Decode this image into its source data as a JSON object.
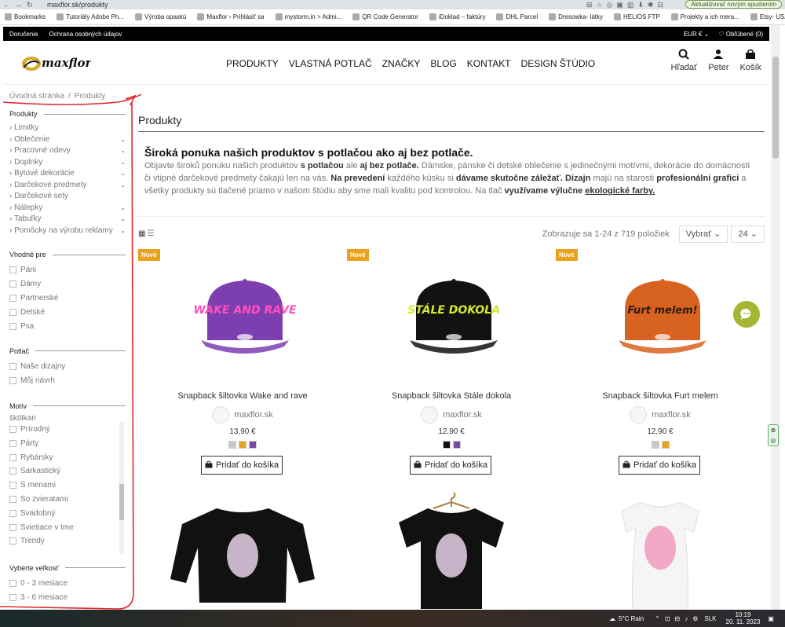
{
  "browser": {
    "url": "maxflor.sk/produkty",
    "update_label": "Aktualizovať  novým spustením",
    "bookmarks": [
      "Bookmarks",
      "Tutoriály Adobe Ph...",
      "Výroba opaskú",
      "Maxflor › Prihlásiť sa",
      "mystorm.in > Admi...",
      "QR Code Generator",
      "iDoklad – faktúry",
      "DHL Parcel",
      "Dresowka- látky",
      "HELIOS FTP",
      "Projekty a ich mera...",
      "Etsy- USA predaj ha..."
    ]
  },
  "topbar": {
    "left_links": [
      "Doručenie",
      "Ochrana osobných údajov"
    ],
    "currency": "EUR € ⌄",
    "favorites": "♡ Obľúbené (0)"
  },
  "header": {
    "logo_text": "maxflor",
    "nav": [
      "PRODUKTY",
      "VLASTNÁ POTLAČ",
      "ZNAČKY",
      "BLOG",
      "KONTAKT",
      "DESIGN ŠTÚDIO"
    ],
    "search_label": "Hľadať",
    "account_label": "Peter",
    "cart_label": "Košík"
  },
  "breadcrumb": [
    "Úvodná stránka",
    "Produkty"
  ],
  "sidebar": {
    "produkty_heading": "Produkty",
    "categories": [
      {
        "label": "Limitky",
        "expandable": false
      },
      {
        "label": "Oblečenie",
        "expandable": true
      },
      {
        "label": "Pracovné odevy",
        "expandable": true
      },
      {
        "label": "Doplnky",
        "expandable": true
      },
      {
        "label": "Bytové dekorácie",
        "expandable": true
      },
      {
        "label": "Darčekové predmety",
        "expandable": true
      },
      {
        "label": "Darčekové sety",
        "expandable": false
      },
      {
        "label": "Nálepky",
        "expandable": true
      },
      {
        "label": "Tabuľky",
        "expandable": true
      },
      {
        "label": "Pomôcky na výrobu reklamy",
        "expandable": true
      }
    ],
    "vhodne_heading": "Vhodné pre",
    "vhodne": [
      "Páni",
      "Dámy",
      "Partnerské",
      "Detské",
      "Psa"
    ],
    "potlac_heading": "Potlač",
    "potlac": [
      "Naše dizajny",
      "Môj návrh"
    ],
    "motiv_heading": "Motív",
    "motiv_partial": "škôlkari",
    "motiv": [
      "Prírodný",
      "Párty",
      "Rybársky",
      "Sarkastický",
      "S menami",
      "So zvieratami",
      "Svadobný",
      "Svietiace v tme",
      "Trendy"
    ],
    "vek_heading": "Vyberte veľkosť",
    "vek": [
      "0 - 3 mesiace",
      "3 - 6 mesiace"
    ]
  },
  "main": {
    "title": "Produkty",
    "intro_heading": "Široká ponuka našich produktov s potlačou ako aj bez potlače.",
    "intro": {
      "t1": "Objavte",
      "t2": " široků ponuku našich produktov ",
      "b1": "s potlačou",
      "t3": " ale ",
      "b2": "aj bez potlače.",
      "t4": " Dámske, pánske či detské oblečenie s jedinečnými motívmi, dekorácie do domácnosti či vtipné darčekové predmety čakajú len na vás. ",
      "b3": "Na prevedení",
      "t5": " každého kúsku si ",
      "b4": "dávame skutočne záležať.",
      "t6": " ",
      "b5": "Dizajn",
      "t7": " majú na starosti ",
      "b6": "profesionálni grafici",
      "t8": " a všetky produkty sú tlačené priamo v našom štúdiu aby sme mali kvalitu pod kontrolou. Na tlač ",
      "b7": "využívame výlučne",
      "t9": " ",
      "u1": "ekologické farby."
    },
    "count_text": "Zobrazuje sa 1-24 z 719 položiek",
    "sort_label": "Vybrať ⌄",
    "perpage_label": "24 ⌄",
    "badge_label": "Nové",
    "add_to_cart": "Pridať do košíka",
    "products": [
      {
        "name": "Snapback šiltovka Wake and rave",
        "vendor": "maxflor.sk",
        "price": "13,90 €",
        "cap_color": "#7d3fb0",
        "print_text": "WAKE AND RAVE",
        "print_color": "#ff4fc1",
        "swatches": [
          "#c9c9c9",
          "#e8a21d",
          "#7a4ba3"
        ]
      },
      {
        "name": "Snapback šiltovka Stále dokola",
        "vendor": "maxflor.sk",
        "price": "12,90 €",
        "cap_color": "#121212",
        "print_text": "STÁLE DOKOLA",
        "print_color": "#d7e82a",
        "swatches": [
          "#111111",
          "#7a4ba3"
        ]
      },
      {
        "name": "Snapback šiltovka Furt melem",
        "vendor": "maxflor.sk",
        "price": "12,90 €",
        "cap_color": "#d8621f",
        "print_text": "Furt melem!",
        "print_color": "#2a1a10",
        "swatches": [
          "#c9c9c9",
          "#e8a21d"
        ]
      }
    ],
    "second_row": [
      {
        "garment": "sweatshirt",
        "color": "#111111"
      },
      {
        "garment": "tshirt-hanger",
        "color": "#111111"
      },
      {
        "garment": "tshirt-women",
        "color": "#f5f5f5"
      }
    ]
  },
  "taskbar": {
    "weather": "5°C  Rain",
    "lang": "SLK",
    "time": "10:19",
    "date": "20. 11. 2023"
  }
}
